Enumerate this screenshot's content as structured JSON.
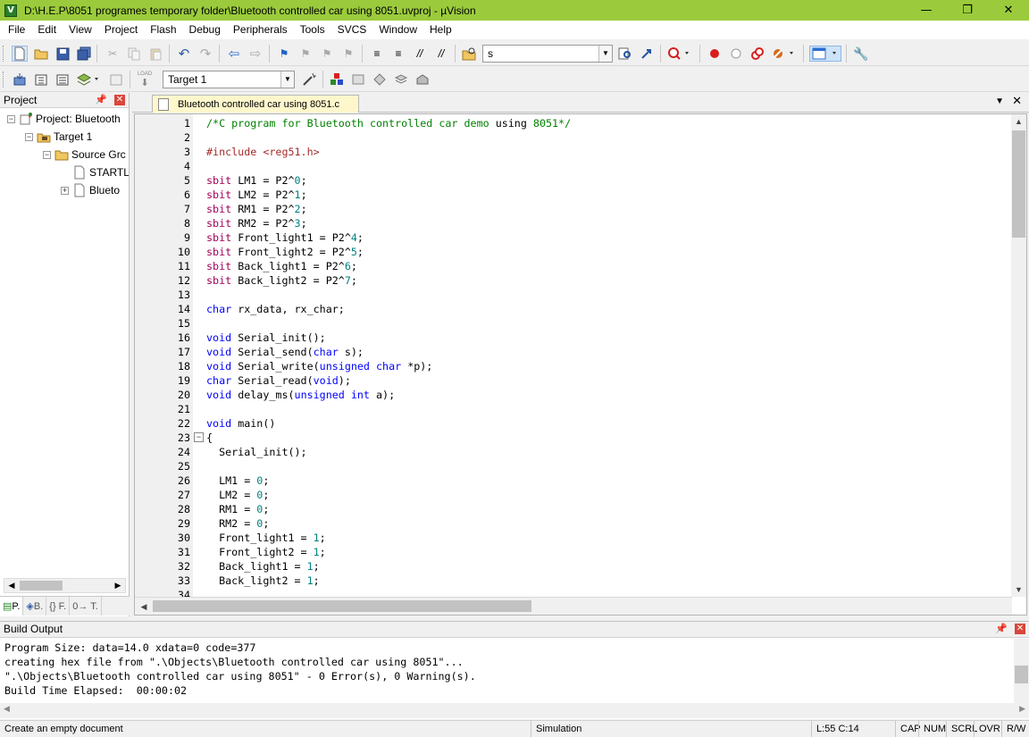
{
  "window": {
    "title": "D:\\H.E.P\\8051 programes temporary folder\\Bluetooth controlled car using 8051.uvproj - µVision",
    "app_icon": "V"
  },
  "menu": [
    "File",
    "Edit",
    "View",
    "Project",
    "Flash",
    "Debug",
    "Peripherals",
    "Tools",
    "SVCS",
    "Window",
    "Help"
  ],
  "toolbar": {
    "find_value": "s",
    "target_value": "Target 1",
    "load_label": "LOAD"
  },
  "project_panel": {
    "title": "Project",
    "tree": [
      {
        "label": "Project: Bluetooth",
        "icon": "project-icon"
      },
      {
        "label": "Target 1",
        "icon": "target-icon"
      },
      {
        "label": "Source Grc",
        "icon": "folder-icon"
      },
      {
        "label": "STARTL",
        "icon": "file-icon"
      },
      {
        "label": "Blueto",
        "icon": "file-icon"
      }
    ],
    "tabs": [
      "P.",
      "B.",
      "{} F.",
      "0→ T."
    ]
  },
  "editor": {
    "tab_label": "Bluetooth controlled car using 8051.c",
    "lines": [
      {
        "n": "1",
        "t": [
          [
            "cmt",
            "/*C program for Bluetooth controlled car demo "
          ],
          [
            "",
            "using"
          ],
          [
            "cmt",
            " 8051*/"
          ]
        ]
      },
      {
        "n": "2",
        "t": []
      },
      {
        "n": "3",
        "t": [
          [
            "pp",
            "#include <reg51.h>"
          ]
        ]
      },
      {
        "n": "4",
        "t": []
      },
      {
        "n": "5",
        "t": [
          [
            "typ",
            "sbit"
          ],
          [
            "",
            " LM1 = P2^"
          ],
          [
            "num",
            "0"
          ],
          [
            "",
            ";"
          ]
        ]
      },
      {
        "n": "6",
        "t": [
          [
            "typ",
            "sbit"
          ],
          [
            "",
            " LM2 = P2^"
          ],
          [
            "num",
            "1"
          ],
          [
            "",
            ";"
          ]
        ]
      },
      {
        "n": "7",
        "t": [
          [
            "typ",
            "sbit"
          ],
          [
            "",
            " RM1 = P2^"
          ],
          [
            "num",
            "2"
          ],
          [
            "",
            ";"
          ]
        ]
      },
      {
        "n": "8",
        "t": [
          [
            "typ",
            "sbit"
          ],
          [
            "",
            " RM2 = P2^"
          ],
          [
            "num",
            "3"
          ],
          [
            "",
            ";"
          ]
        ]
      },
      {
        "n": "9",
        "t": [
          [
            "typ",
            "sbit"
          ],
          [
            "",
            " Front_light1 = P2^"
          ],
          [
            "num",
            "4"
          ],
          [
            "",
            ";"
          ]
        ]
      },
      {
        "n": "10",
        "t": [
          [
            "typ",
            "sbit"
          ],
          [
            "",
            " Front_light2 = P2^"
          ],
          [
            "num",
            "5"
          ],
          [
            "",
            ";"
          ]
        ]
      },
      {
        "n": "11",
        "t": [
          [
            "typ",
            "sbit"
          ],
          [
            "",
            " Back_light1 = P2^"
          ],
          [
            "num",
            "6"
          ],
          [
            "",
            ";"
          ]
        ]
      },
      {
        "n": "12",
        "t": [
          [
            "typ",
            "sbit"
          ],
          [
            "",
            " Back_light2 = P2^"
          ],
          [
            "num",
            "7"
          ],
          [
            "",
            ";"
          ]
        ]
      },
      {
        "n": "13",
        "t": []
      },
      {
        "n": "14",
        "t": [
          [
            "kw",
            "char"
          ],
          [
            "",
            " rx_data, rx_char;"
          ]
        ]
      },
      {
        "n": "15",
        "t": []
      },
      {
        "n": "16",
        "t": [
          [
            "kw",
            "void"
          ],
          [
            "",
            " Serial_init();"
          ]
        ]
      },
      {
        "n": "17",
        "t": [
          [
            "kw",
            "void"
          ],
          [
            "",
            " Serial_send("
          ],
          [
            "kw",
            "char"
          ],
          [
            "",
            " s);"
          ]
        ]
      },
      {
        "n": "18",
        "t": [
          [
            "kw",
            "void"
          ],
          [
            "",
            " Serial_write("
          ],
          [
            "kw",
            "unsigned char"
          ],
          [
            "",
            " *p);"
          ]
        ]
      },
      {
        "n": "19",
        "t": [
          [
            "kw",
            "char"
          ],
          [
            "",
            " Serial_read("
          ],
          [
            "kw",
            "void"
          ],
          [
            "",
            ");"
          ]
        ]
      },
      {
        "n": "20",
        "t": [
          [
            "kw",
            "void"
          ],
          [
            "",
            " delay_ms("
          ],
          [
            "kw",
            "unsigned int"
          ],
          [
            "",
            " a);"
          ]
        ]
      },
      {
        "n": "21",
        "t": []
      },
      {
        "n": "22",
        "t": [
          [
            "kw",
            "void"
          ],
          [
            "",
            " main()"
          ]
        ]
      },
      {
        "n": "23",
        "t": [
          [
            "",
            "{"
          ]
        ],
        "fold": "−"
      },
      {
        "n": "24",
        "t": [
          [
            "",
            "  Serial_init();"
          ]
        ]
      },
      {
        "n": "25",
        "t": []
      },
      {
        "n": "26",
        "t": [
          [
            "",
            "  LM1 = "
          ],
          [
            "num",
            "0"
          ],
          [
            "",
            ";"
          ]
        ]
      },
      {
        "n": "27",
        "t": [
          [
            "",
            "  LM2 = "
          ],
          [
            "num",
            "0"
          ],
          [
            "",
            ";"
          ]
        ]
      },
      {
        "n": "28",
        "t": [
          [
            "",
            "  RM1 = "
          ],
          [
            "num",
            "0"
          ],
          [
            "",
            ";"
          ]
        ]
      },
      {
        "n": "29",
        "t": [
          [
            "",
            "  RM2 = "
          ],
          [
            "num",
            "0"
          ],
          [
            "",
            ";"
          ]
        ]
      },
      {
        "n": "30",
        "t": [
          [
            "",
            "  Front_light1 = "
          ],
          [
            "num",
            "1"
          ],
          [
            "",
            ";"
          ]
        ]
      },
      {
        "n": "31",
        "t": [
          [
            "",
            "  Front_light2 = "
          ],
          [
            "num",
            "1"
          ],
          [
            "",
            ";"
          ]
        ]
      },
      {
        "n": "32",
        "t": [
          [
            "",
            "  Back_light1 = "
          ],
          [
            "num",
            "1"
          ],
          [
            "",
            ";"
          ]
        ]
      },
      {
        "n": "33",
        "t": [
          [
            "",
            "  Back_light2 = "
          ],
          [
            "num",
            "1"
          ],
          [
            "",
            ";"
          ]
        ]
      },
      {
        "n": "34",
        "t": []
      }
    ]
  },
  "build_output": {
    "title": "Build Output",
    "lines": [
      "Program Size: data=14.0 xdata=0 code=377",
      "creating hex file from \".\\Objects\\Bluetooth controlled car using 8051\"...",
      "\".\\Objects\\Bluetooth controlled car using 8051\" - 0 Error(s), 0 Warning(s).",
      "Build Time Elapsed:  00:00:02"
    ]
  },
  "status": {
    "hint": "Create an empty document",
    "mode": "Simulation",
    "position": "L:55 C:14",
    "cap": "CAP",
    "num": "NUM",
    "scrl": "SCRL",
    "ovr": "OVR",
    "rw": "R/W"
  },
  "colors": {
    "titlebar": "#9bcb3c",
    "comment": "#008000",
    "keyword": "#0000ff",
    "type": "#a0005a",
    "number": "#008080",
    "preprocessor": "#a52a2a",
    "active_tab": "#fff7cc"
  }
}
